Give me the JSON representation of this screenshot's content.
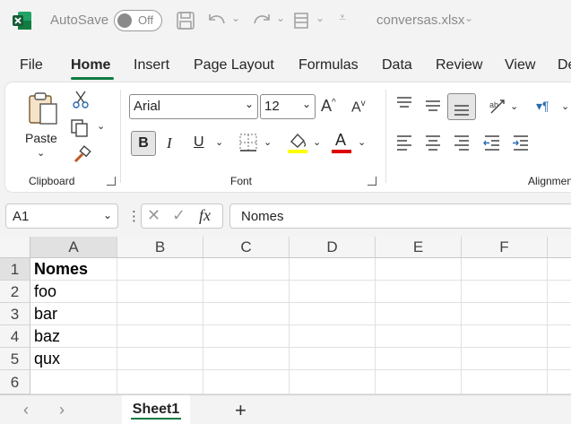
{
  "titlebar": {
    "autosave_label": "AutoSave",
    "autosave_state": "Off",
    "filename": "conversas.xlsx"
  },
  "tabs": [
    {
      "label": "File"
    },
    {
      "label": "Home",
      "active": true
    },
    {
      "label": "Insert"
    },
    {
      "label": "Page Layout"
    },
    {
      "label": "Formulas"
    },
    {
      "label": "Data"
    },
    {
      "label": "Review"
    },
    {
      "label": "View"
    },
    {
      "label": "De"
    }
  ],
  "ribbon": {
    "clipboard": {
      "paste_label": "Paste",
      "group_label": "Clipboard"
    },
    "font": {
      "font_name": "Arial",
      "font_size": "12",
      "group_label": "Font",
      "bold": "B",
      "italic": "I",
      "underline": "U",
      "font_color_letter": "A",
      "grow_letter": "A",
      "shrink_letter": "A"
    },
    "alignment": {
      "group_label": "Alignmen"
    }
  },
  "formula_bar": {
    "name_box": "A1",
    "fx": "fx",
    "content": "Nomes"
  },
  "grid": {
    "columns": [
      "A",
      "B",
      "C",
      "D",
      "E",
      "F"
    ],
    "rows": [
      "1",
      "2",
      "3",
      "4",
      "5",
      "6"
    ],
    "cells": {
      "A1": "Nomes",
      "A2": "foo",
      "A3": "bar",
      "A4": "baz",
      "A5": "qux"
    }
  },
  "sheets": [
    {
      "name": "Sheet1",
      "active": true
    }
  ],
  "colors": {
    "accent": "#107c41",
    "font_color": "#e00000",
    "highlight": "#ffff00"
  }
}
